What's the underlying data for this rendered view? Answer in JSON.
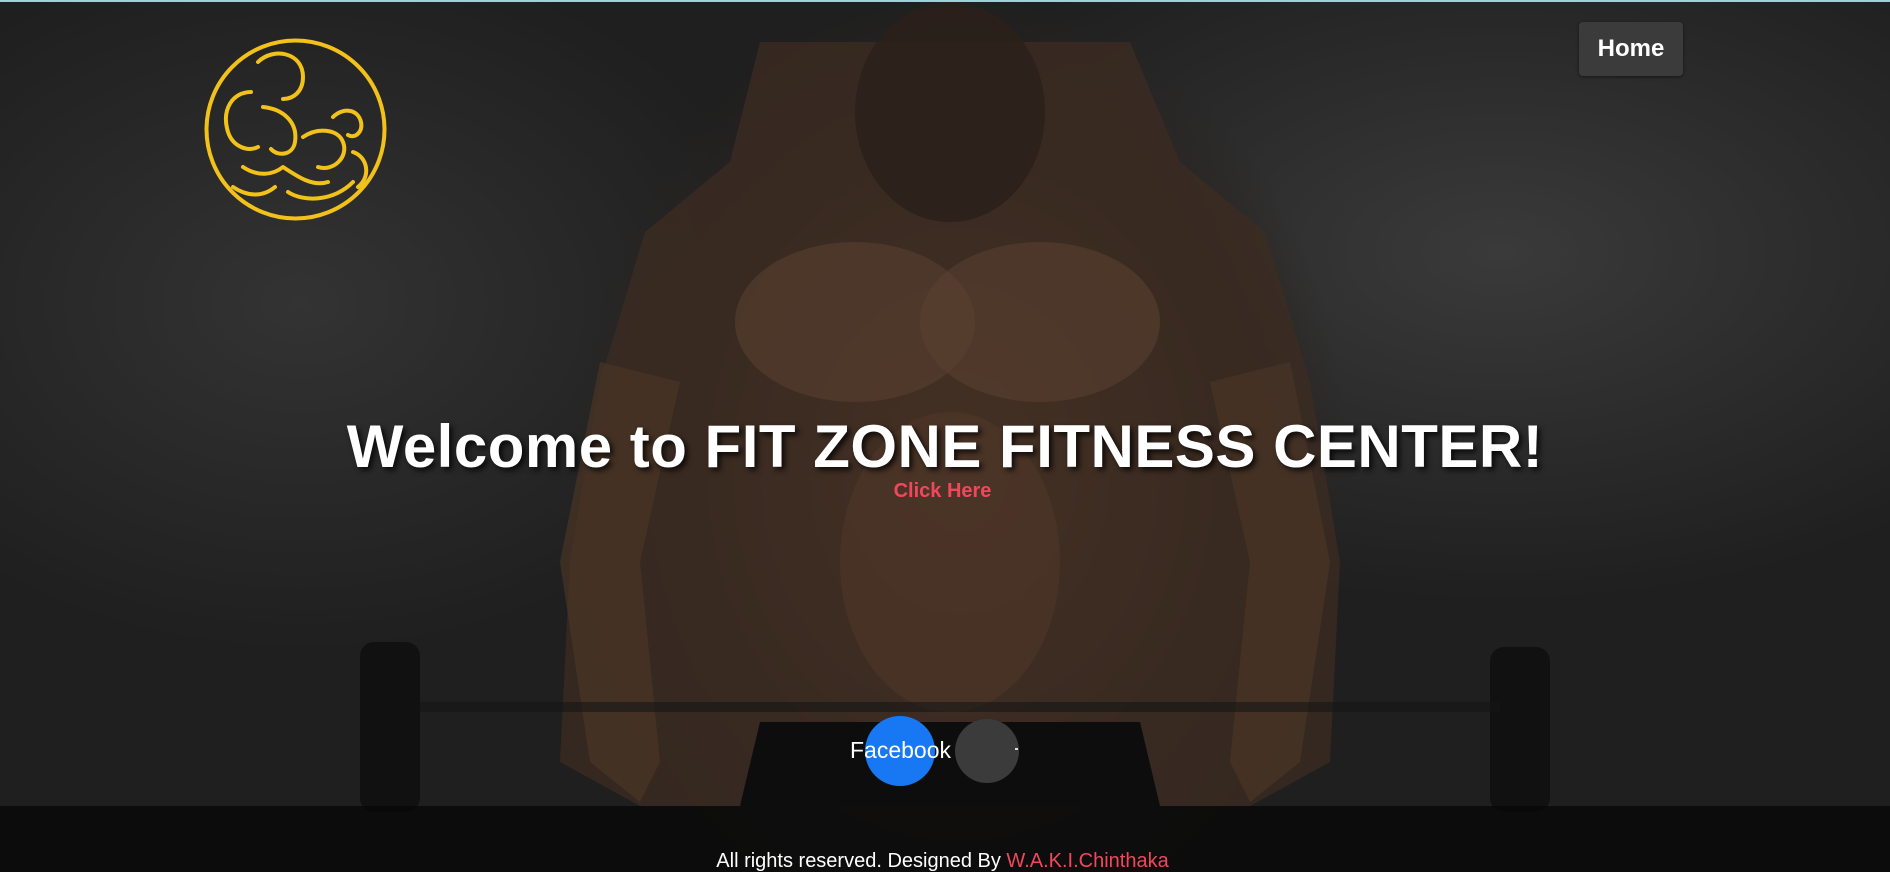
{
  "nav": {
    "home_label": "Home"
  },
  "logo": {
    "icon": "bodybuilder-emblem-icon",
    "color": "#f2c21b"
  },
  "hero": {
    "title": "Welcome to FIT ZONE FITNESS CENTER!",
    "cta_label": "Click Here",
    "cta_color": "#f1475d"
  },
  "social": {
    "facebook_label": "Facebook",
    "facebook_color": "#1877f2",
    "second_icon": "social-icon"
  },
  "footer": {
    "text": "All rights reserved. Designed By",
    "author": "W.A.K.I.Chinthaka",
    "author_color": "#f1475d"
  }
}
